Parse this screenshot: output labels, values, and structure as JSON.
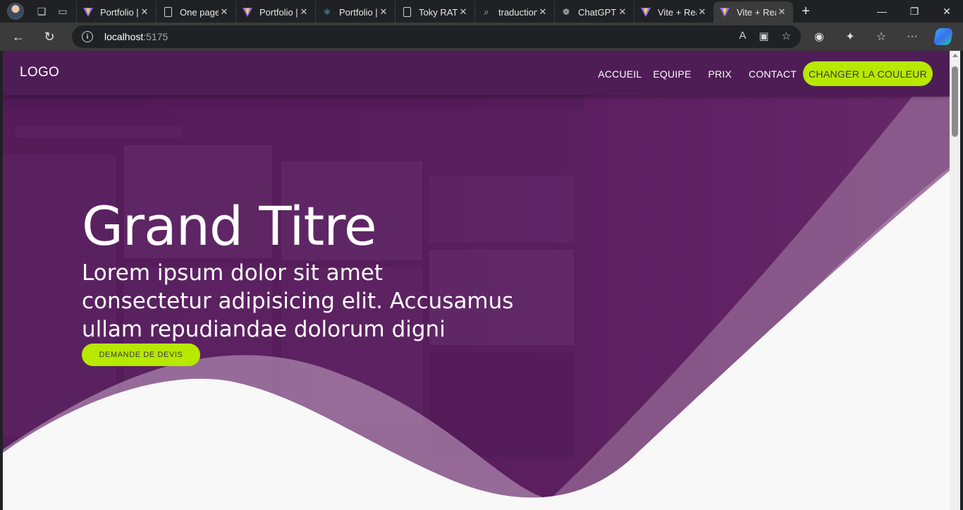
{
  "browser": {
    "tabs": [
      {
        "title": "Portfolio |",
        "icon": "vite-icon"
      },
      {
        "title": "One page",
        "icon": "page-icon"
      },
      {
        "title": "Portfolio |",
        "icon": "vite-icon"
      },
      {
        "title": "Portfolio |",
        "icon": "react-icon"
      },
      {
        "title": "Toky RATO",
        "icon": "page-icon"
      },
      {
        "title": "traduction",
        "icon": "search-icon"
      },
      {
        "title": "ChatGPT",
        "icon": "chatgpt-icon"
      },
      {
        "title": "Vite + Rea",
        "icon": "vite-icon"
      },
      {
        "title": "Vite + Rea",
        "icon": "vite-icon",
        "active": true
      }
    ],
    "address": {
      "host": "localhost",
      "port": ":5175"
    }
  },
  "site": {
    "logo": "LOGO",
    "menu": {
      "accueil": "ACCUEIL",
      "equipe": "EQUIPE",
      "prix": "PRIX",
      "contact": "CONTACT",
      "change_color": "CHANGER LA COULEUR"
    },
    "hero": {
      "title": "Grand Titre",
      "subtitle": "Lorem ipsum dolor sit amet consectetur adipisicing elit. Accusamus ullam repudiandae dolorum digni",
      "cta": "DEMANDE DE DEVIS"
    }
  },
  "colors": {
    "header_bg": "#4f1d56",
    "accent": "#b7e800",
    "wave_light": "#f8f8f8",
    "wave_mid": "#9b7a9e"
  }
}
